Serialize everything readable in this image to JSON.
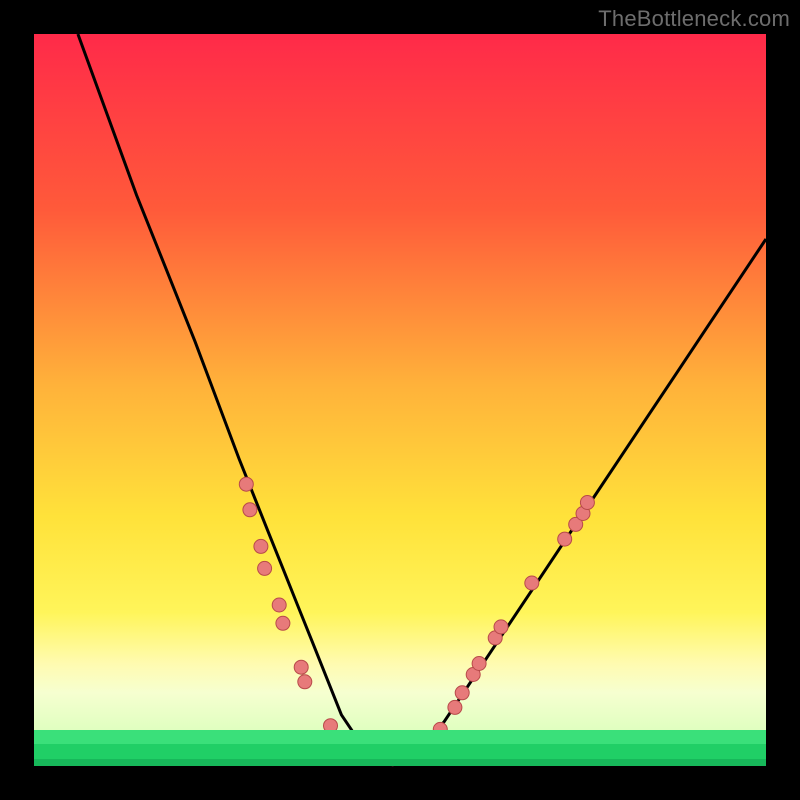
{
  "watermark": "TheBottleneck.com",
  "gradient": {
    "stops": [
      {
        "pos": 0,
        "color": "#ff2a49"
      },
      {
        "pos": 24,
        "color": "#ff5a3a"
      },
      {
        "pos": 48,
        "color": "#ffb23a"
      },
      {
        "pos": 66,
        "color": "#ffe23a"
      },
      {
        "pos": 79,
        "color": "#fff55a"
      },
      {
        "pos": 86,
        "color": "#fffbb0"
      },
      {
        "pos": 90,
        "color": "#f6ffd0"
      },
      {
        "pos": 100,
        "color": "#caffb0"
      }
    ]
  },
  "green_bands": [
    {
      "top_pct": 95.1,
      "height_pct": 1.9,
      "color": "#3ae07a"
    },
    {
      "top_pct": 97.0,
      "height_pct": 2.0,
      "color": "#20cf66"
    },
    {
      "top_pct": 99.0,
      "height_pct": 1.0,
      "color": "#17b85a"
    }
  ],
  "curve": {
    "stroke": "#000000",
    "stroke_width": 3
  },
  "dot_style": {
    "fill": "#e77a7a",
    "stroke": "#b84a4a",
    "r": 7
  },
  "chart_data": {
    "type": "line",
    "title": "",
    "xlabel": "",
    "ylabel": "",
    "xlim": [
      0,
      100
    ],
    "ylim": [
      0,
      100
    ],
    "annotations": [
      "TheBottleneck.com"
    ],
    "series": [
      {
        "name": "curve",
        "x": [
          6,
          10,
          14,
          18,
          22,
          25,
          28,
          30,
          32,
          34,
          36,
          38,
          40,
          42,
          44,
          46,
          48,
          50,
          52,
          56,
          60,
          64,
          68,
          72,
          76,
          80,
          84,
          88,
          92,
          96,
          100
        ],
        "y": [
          100,
          89,
          78,
          68,
          58,
          50,
          42,
          37,
          32,
          27,
          22,
          17,
          12,
          7,
          4,
          2,
          1,
          1,
          2,
          6,
          12,
          18,
          24,
          30,
          36,
          42,
          48,
          54,
          60,
          66,
          72
        ]
      }
    ],
    "dots": [
      {
        "x": 29.0,
        "y": 38.5
      },
      {
        "x": 29.5,
        "y": 35.0
      },
      {
        "x": 31.0,
        "y": 30.0
      },
      {
        "x": 31.5,
        "y": 27.0
      },
      {
        "x": 33.5,
        "y": 22.0
      },
      {
        "x": 34.0,
        "y": 19.5
      },
      {
        "x": 36.5,
        "y": 13.5
      },
      {
        "x": 37.0,
        "y": 11.5
      },
      {
        "x": 40.5,
        "y": 5.5
      },
      {
        "x": 43.0,
        "y": 3.0
      },
      {
        "x": 45.0,
        "y": 2.0
      },
      {
        "x": 47.0,
        "y": 1.2
      },
      {
        "x": 49.0,
        "y": 1.0
      },
      {
        "x": 51.0,
        "y": 1.2
      },
      {
        "x": 53.0,
        "y": 2.2
      },
      {
        "x": 55.5,
        "y": 5.0
      },
      {
        "x": 57.5,
        "y": 8.0
      },
      {
        "x": 58.5,
        "y": 10.0
      },
      {
        "x": 60.0,
        "y": 12.5
      },
      {
        "x": 60.8,
        "y": 14.0
      },
      {
        "x": 63.0,
        "y": 17.5
      },
      {
        "x": 63.8,
        "y": 19.0
      },
      {
        "x": 68.0,
        "y": 25.0
      },
      {
        "x": 72.5,
        "y": 31.0
      },
      {
        "x": 74.0,
        "y": 33.0
      },
      {
        "x": 75.0,
        "y": 34.5
      },
      {
        "x": 75.6,
        "y": 36.0
      }
    ]
  }
}
